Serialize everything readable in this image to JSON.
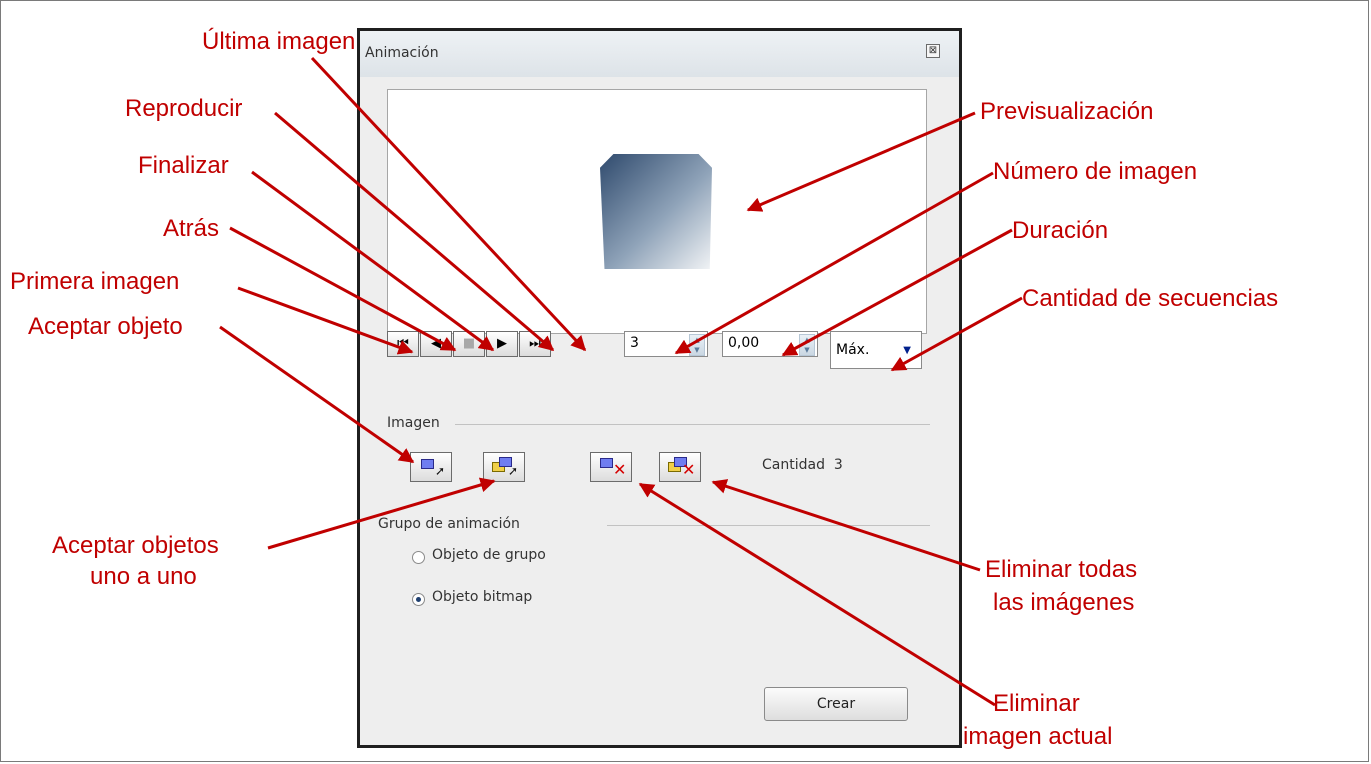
{
  "dialog": {
    "title": "Animación",
    "close_glyph": "⊠",
    "nav": {
      "first": "⏮",
      "back": "◀",
      "stop": "■",
      "play": "▶",
      "last": "⏭"
    },
    "image_number": "3",
    "duration": "0,00",
    "loop_count": "Máx.",
    "image_section_label": "Imagen",
    "count_label": "Cantidad",
    "count_value": "3",
    "group_section_label": "Grupo de animación",
    "radio_group_object": "Objeto de grupo",
    "radio_bitmap_object": "Objeto bitmap",
    "radio_selected": "bitmap",
    "create_label": "Crear"
  },
  "callouts": {
    "last_image": "Última imagen",
    "play": "Reproducir",
    "stop": "Finalizar",
    "back": "Atrás",
    "first_image": "Primera imagen",
    "preview": "Previsualización",
    "image_number": "Número de imagen",
    "duration": "Duración",
    "loop_count": "Cantidad de secuencias",
    "apply_object": "Aceptar objeto",
    "apply_objects_line1": "Aceptar objetos",
    "apply_objects_line2": "uno a uno",
    "delete_all_line1": "Eliminar todas",
    "delete_all_line2": "las imágenes",
    "delete_current_line1": "Eliminar",
    "delete_current_line2": "imagen actual"
  },
  "colors": {
    "callout": "#c00000",
    "dialog_bg": "#eeeeee"
  }
}
